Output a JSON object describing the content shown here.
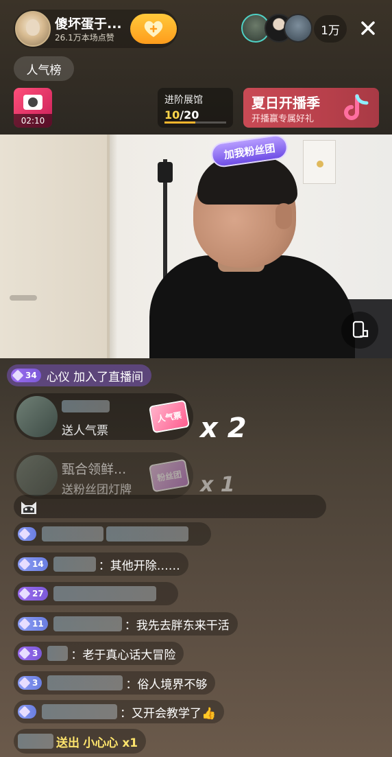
{
  "header": {
    "host_name": "傻坏蛋于...",
    "host_likes": "26.1万本场点赞",
    "viewer_count": "1万",
    "close_icon": "close-icon",
    "follow_icon": "heart-plus-icon"
  },
  "rank_button": "人气榜",
  "promo": {
    "timer": "02:10"
  },
  "exhibition_hall": {
    "title": "进阶展馆",
    "current": "10",
    "total": "/20",
    "progress": 0.5
  },
  "summer_banner": {
    "title": "夏日开播季",
    "subtitle": "开播赢专属好礼"
  },
  "video": {
    "fan_badge": "加我粉丝团"
  },
  "join_message": {
    "level": "34",
    "user": "心仪",
    "text": "加入了直播间"
  },
  "gifts": [
    {
      "name": "",
      "action": "送人气票",
      "icon_label": "人气票",
      "multiplier": "x 2"
    },
    {
      "name": "甄合领鲜...",
      "action": "送粉丝团灯牌",
      "icon_label": "粉丝团",
      "multiplier": "x 1"
    }
  ],
  "comments": [
    {
      "level": "",
      "text": ""
    },
    {
      "level": "14",
      "text": "：其他开除……"
    },
    {
      "level": "27",
      "text": ""
    },
    {
      "level": "11",
      "text": "：我先去胖东来干活"
    },
    {
      "level": "3",
      "text": "：老于真心话大冒险"
    },
    {
      "level": "3",
      "text": "：俗人境界不够"
    },
    {
      "level": "",
      "text": "：又开会教学了👍"
    }
  ],
  "send_message": {
    "verb": "送出",
    "gift": "小心心 x1"
  },
  "colors": {
    "accent_gold": "#ffd64a",
    "summer_red": "#c94a55",
    "level_purple": "#8b6ae8"
  }
}
